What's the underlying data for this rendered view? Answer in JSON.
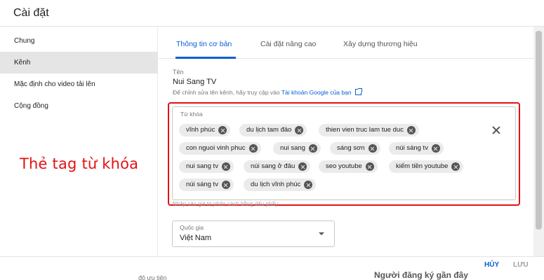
{
  "dialog": {
    "title": "Cài đặt"
  },
  "sidebar": {
    "items": [
      {
        "label": "Chung"
      },
      {
        "label": "Kênh"
      },
      {
        "label": "Mặc định cho video tải lên"
      },
      {
        "label": "Cộng đồng"
      }
    ]
  },
  "annotation": "Thẻ tag từ khóa",
  "tabs": [
    {
      "label": "Thông tin cơ bản"
    },
    {
      "label": "Cài đặt nâng cao"
    },
    {
      "label": "Xây dựng thương hiệu"
    }
  ],
  "channel_name": {
    "label": "Tên",
    "value": "Nui Sang TV",
    "help_text": "Để chỉnh sửa tên kênh, hãy truy cập vào",
    "help_link": "Tài khoản Google của bạn"
  },
  "keywords": {
    "label": "Từ khóa",
    "chips": [
      "vĩnh phúc",
      "du lịch tam đảo",
      "thien vien truc lam tue duc",
      "con nguoi vinh phuc",
      "nui sang",
      "sáng sơn",
      "núi sáng tv",
      "nui sang tv",
      "núi sang ở đâu",
      "seo youtube",
      "kiếm tiền youtube",
      "núi sáng tv",
      "du lịch vĩnh phúc"
    ],
    "hint": "Nhập các giá trị phân cách bằng dấu phẩy"
  },
  "country": {
    "label": "Quốc gia",
    "value": "Việt Nam"
  },
  "footer": {
    "cancel_label": "HỦY",
    "save_label": "LƯU"
  },
  "background_peek": {
    "left_text": "độ ưu tiên",
    "right_text": "Người đăng ký gần đây"
  },
  "colors": {
    "accent": "#065fd4",
    "annotation": "#e31212",
    "chip_bg": "#ebebeb"
  },
  "icons": {
    "chip_remove": "close-circle-icon",
    "clear_all": "close-icon",
    "external_link": "external-link-icon",
    "dropdown": "caret-down-icon"
  }
}
